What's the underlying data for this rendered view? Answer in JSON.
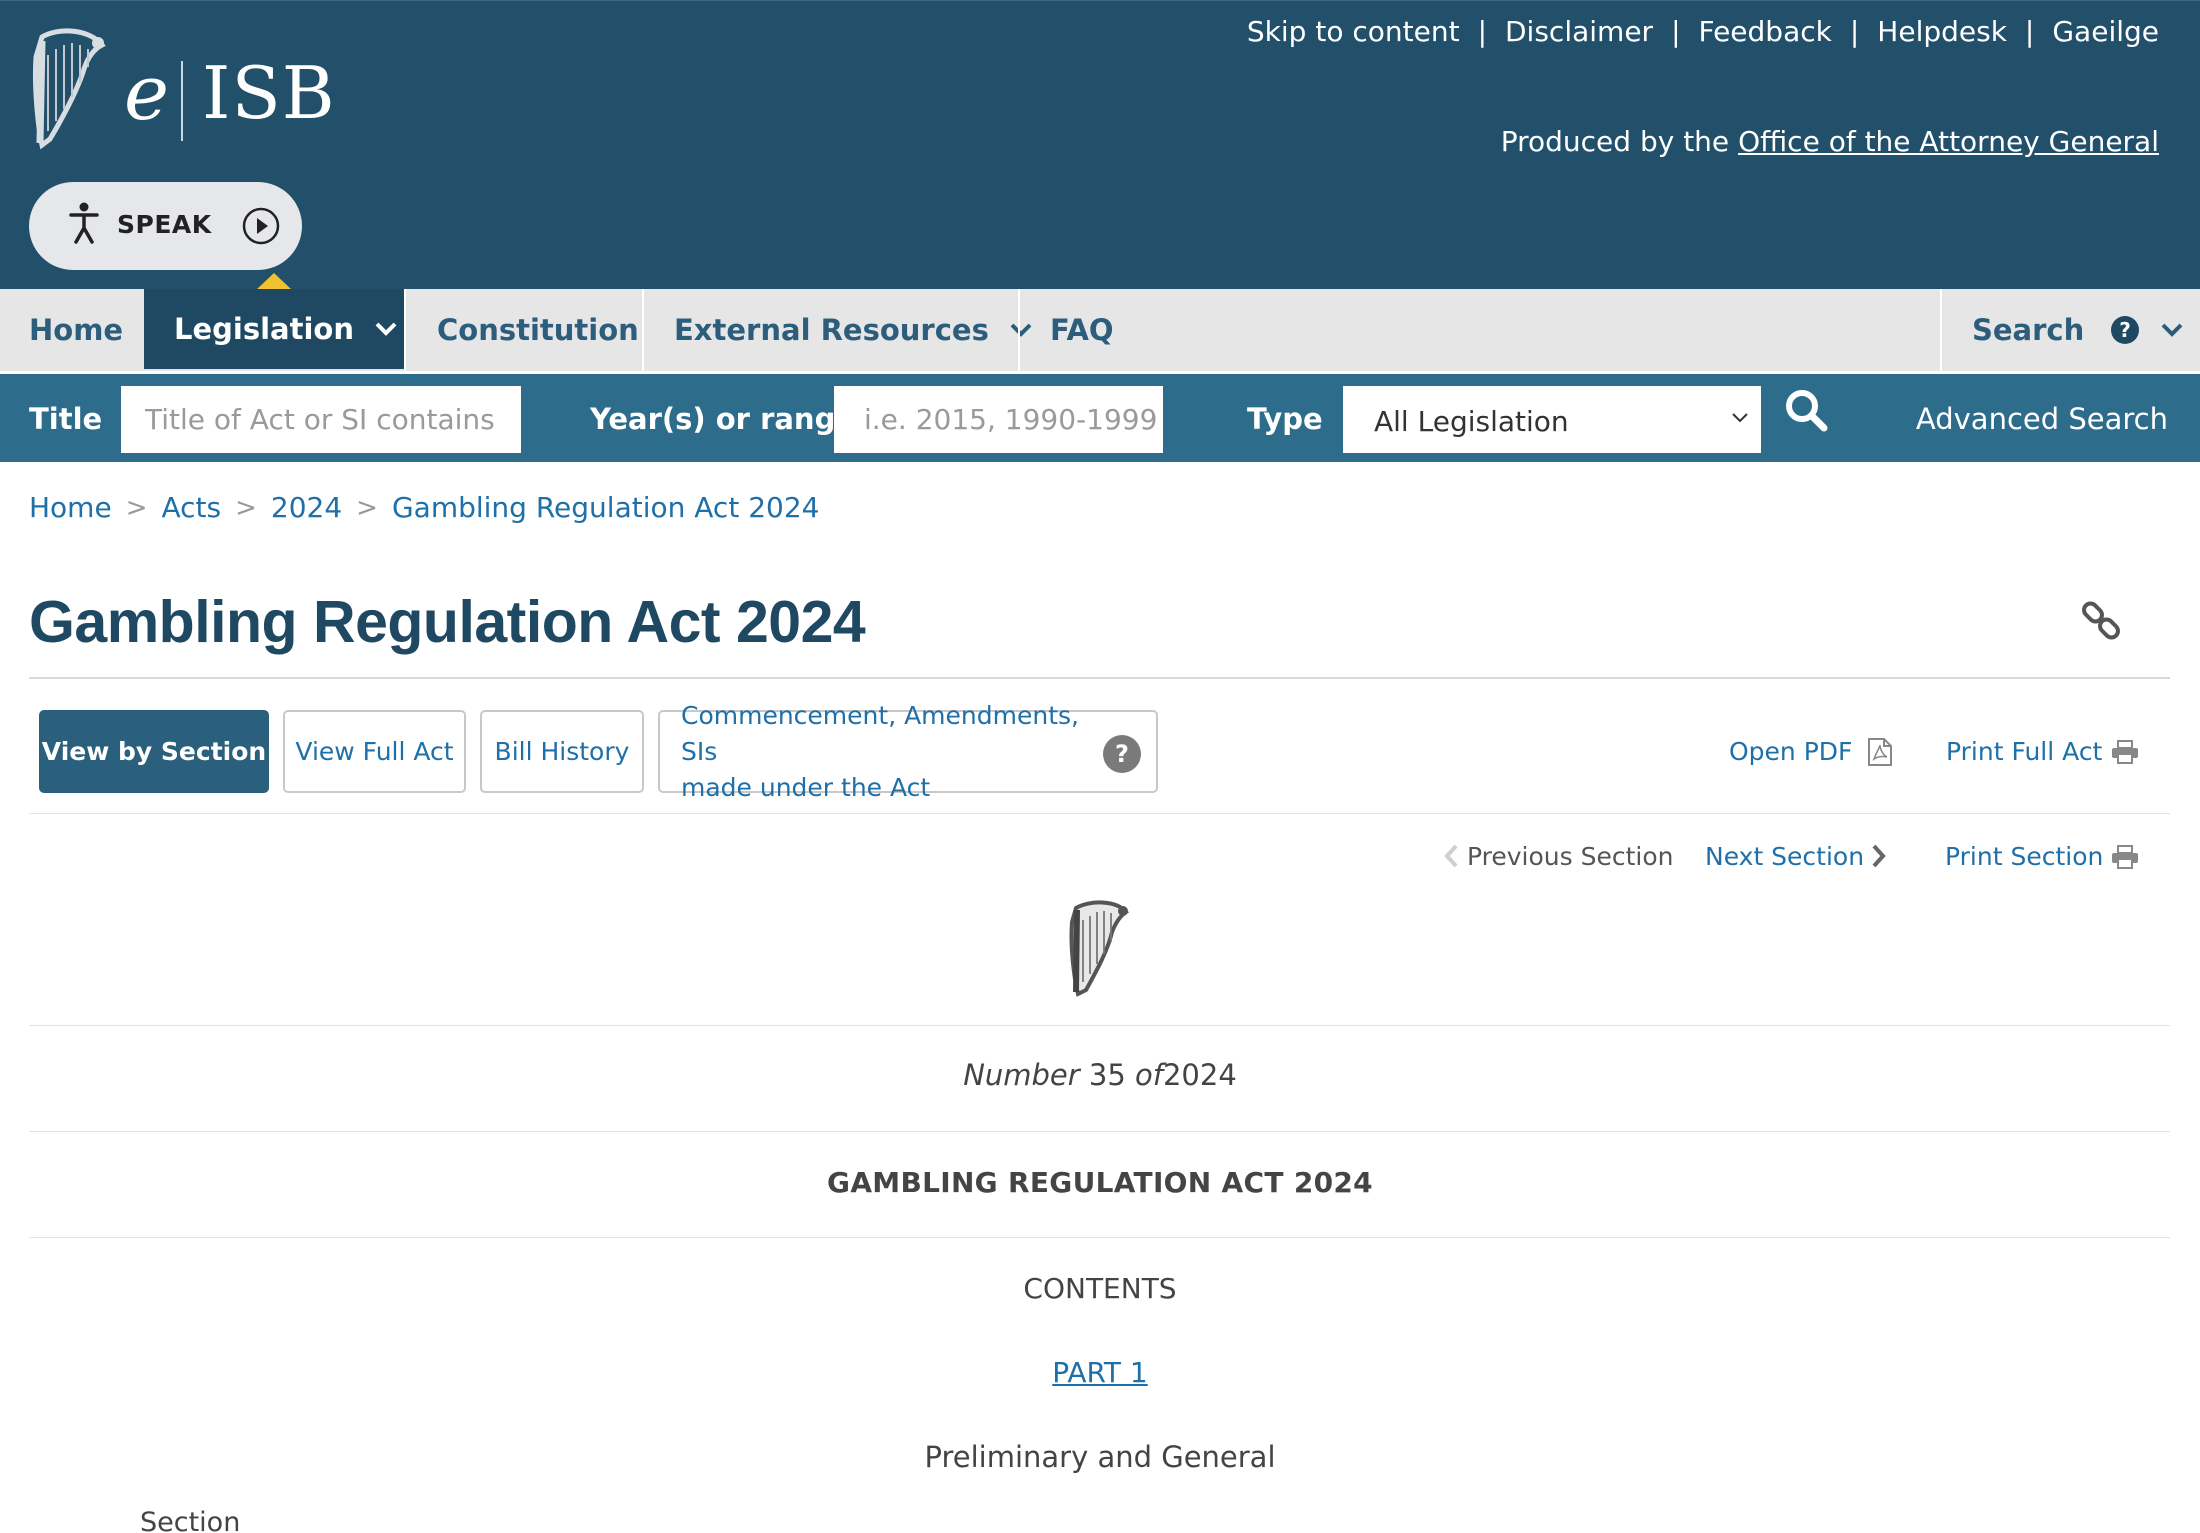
{
  "header": {
    "logo_e": "e",
    "logo_isb": "ISB",
    "top_links": [
      "Skip to content",
      "Disclaimer",
      "Feedback",
      "Helpdesk",
      "Gaeilge"
    ],
    "produced_prefix": "Produced by the",
    "produced_link": "Office of the Attorney General",
    "speak_label": "SPEAK"
  },
  "nav": {
    "home": "Home",
    "legislation": "Legislation",
    "constitution": "Constitution",
    "external_resources": "External Resources",
    "faq": "FAQ",
    "search": "Search"
  },
  "search": {
    "title_label": "Title",
    "title_placeholder": "Title of Act or SI contains",
    "year_label": "Year(s) or range",
    "year_placeholder": "i.e. 2015, 1990-1999",
    "type_label": "Type",
    "type_value": "All Legislation",
    "advanced": "Advanced Search"
  },
  "breadcrumb": [
    "Home",
    "Acts",
    "2024",
    "Gambling Regulation Act 2024"
  ],
  "page_title": "Gambling Regulation Act 2024",
  "tabs": {
    "view_by_section": "View by Section",
    "view_full_act": "View Full Act",
    "bill_history": "Bill History",
    "commencement_line1": "Commencement, Amendments, SIs",
    "commencement_line2": "made under the Act"
  },
  "actions": {
    "open_pdf": "Open PDF",
    "print_full_act": "Print Full Act"
  },
  "section_nav": {
    "previous": "Previous Section",
    "next": "Next Section",
    "print": "Print Section"
  },
  "document": {
    "number_word": "Number",
    "number": "35",
    "of_word": "of",
    "year": "2024",
    "act_name": "GAMBLING REGULATION ACT 2024",
    "contents": "CONTENTS",
    "part": "PART 1",
    "part_subtitle": "Preliminary and General",
    "section_label": "Section"
  },
  "icons": {
    "harp": "harp-icon",
    "speak_person": "accessibility-person-icon",
    "play": "play-circle-icon",
    "chevron": "chevron-down-icon",
    "help": "question-circle-icon",
    "search": "magnifier-icon",
    "link": "link-chain-icon",
    "pdf": "pdf-file-icon",
    "print": "printer-icon",
    "chevron_left": "chevron-left-icon",
    "chevron_right": "chevron-right-icon"
  },
  "colors": {
    "header_bg": "#224f6a",
    "nav_bg": "#e6e6e6",
    "nav_active": "#1f4962",
    "search_bg": "#2e6c8c",
    "link": "#1f6fa8",
    "accent": "#f0c230"
  }
}
